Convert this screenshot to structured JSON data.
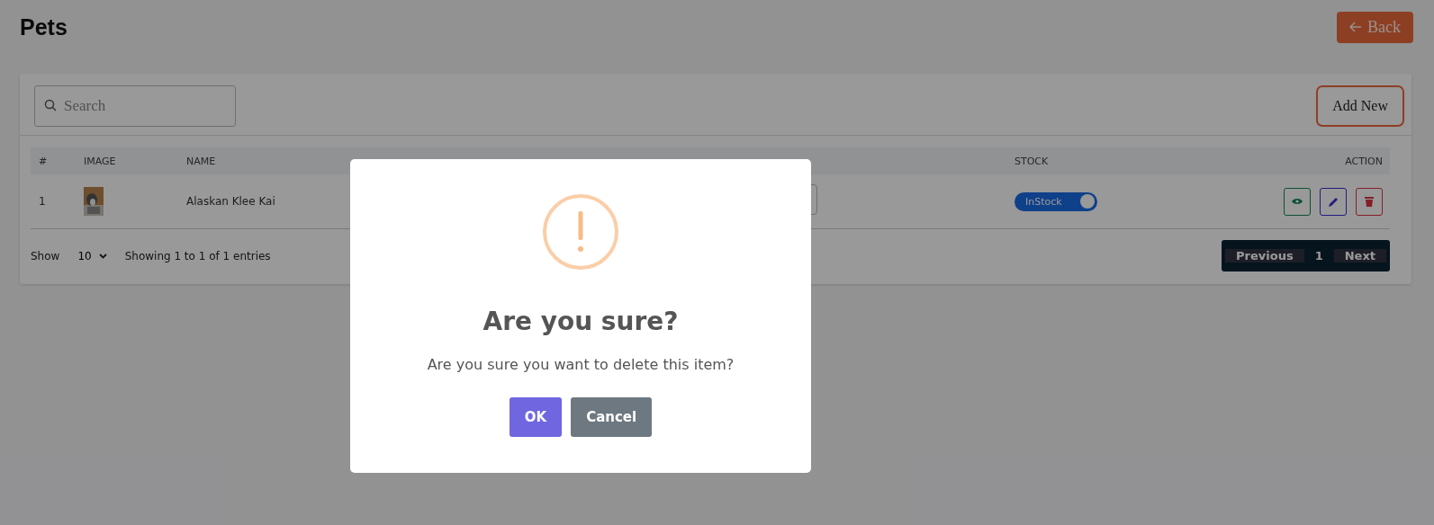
{
  "page": {
    "title": "Pets",
    "back_button": "Back"
  },
  "toolbar": {
    "search": {
      "placeholder": "Search"
    },
    "add_button": "Add New"
  },
  "table": {
    "columns": [
      "#",
      "IMAGE",
      "NAME",
      "STOCK",
      "ACTION"
    ],
    "rows": [
      {
        "number": "1",
        "name": "Alaskan Klee Kai",
        "stock": {
          "label": "InStock",
          "on": true
        }
      }
    ]
  },
  "footer": {
    "show_label": "Show",
    "page_size": "10",
    "info": "Showing 1 to 1 of 1 entries",
    "pagination": {
      "previous": "Previous",
      "pages": [
        {
          "label": "1",
          "selected": true
        }
      ],
      "next": "Next"
    }
  },
  "dialog": {
    "title": "Are you sure?",
    "message": "Are you sure you want to delete this item?",
    "ok": "OK",
    "cancel": "Cancel"
  }
}
